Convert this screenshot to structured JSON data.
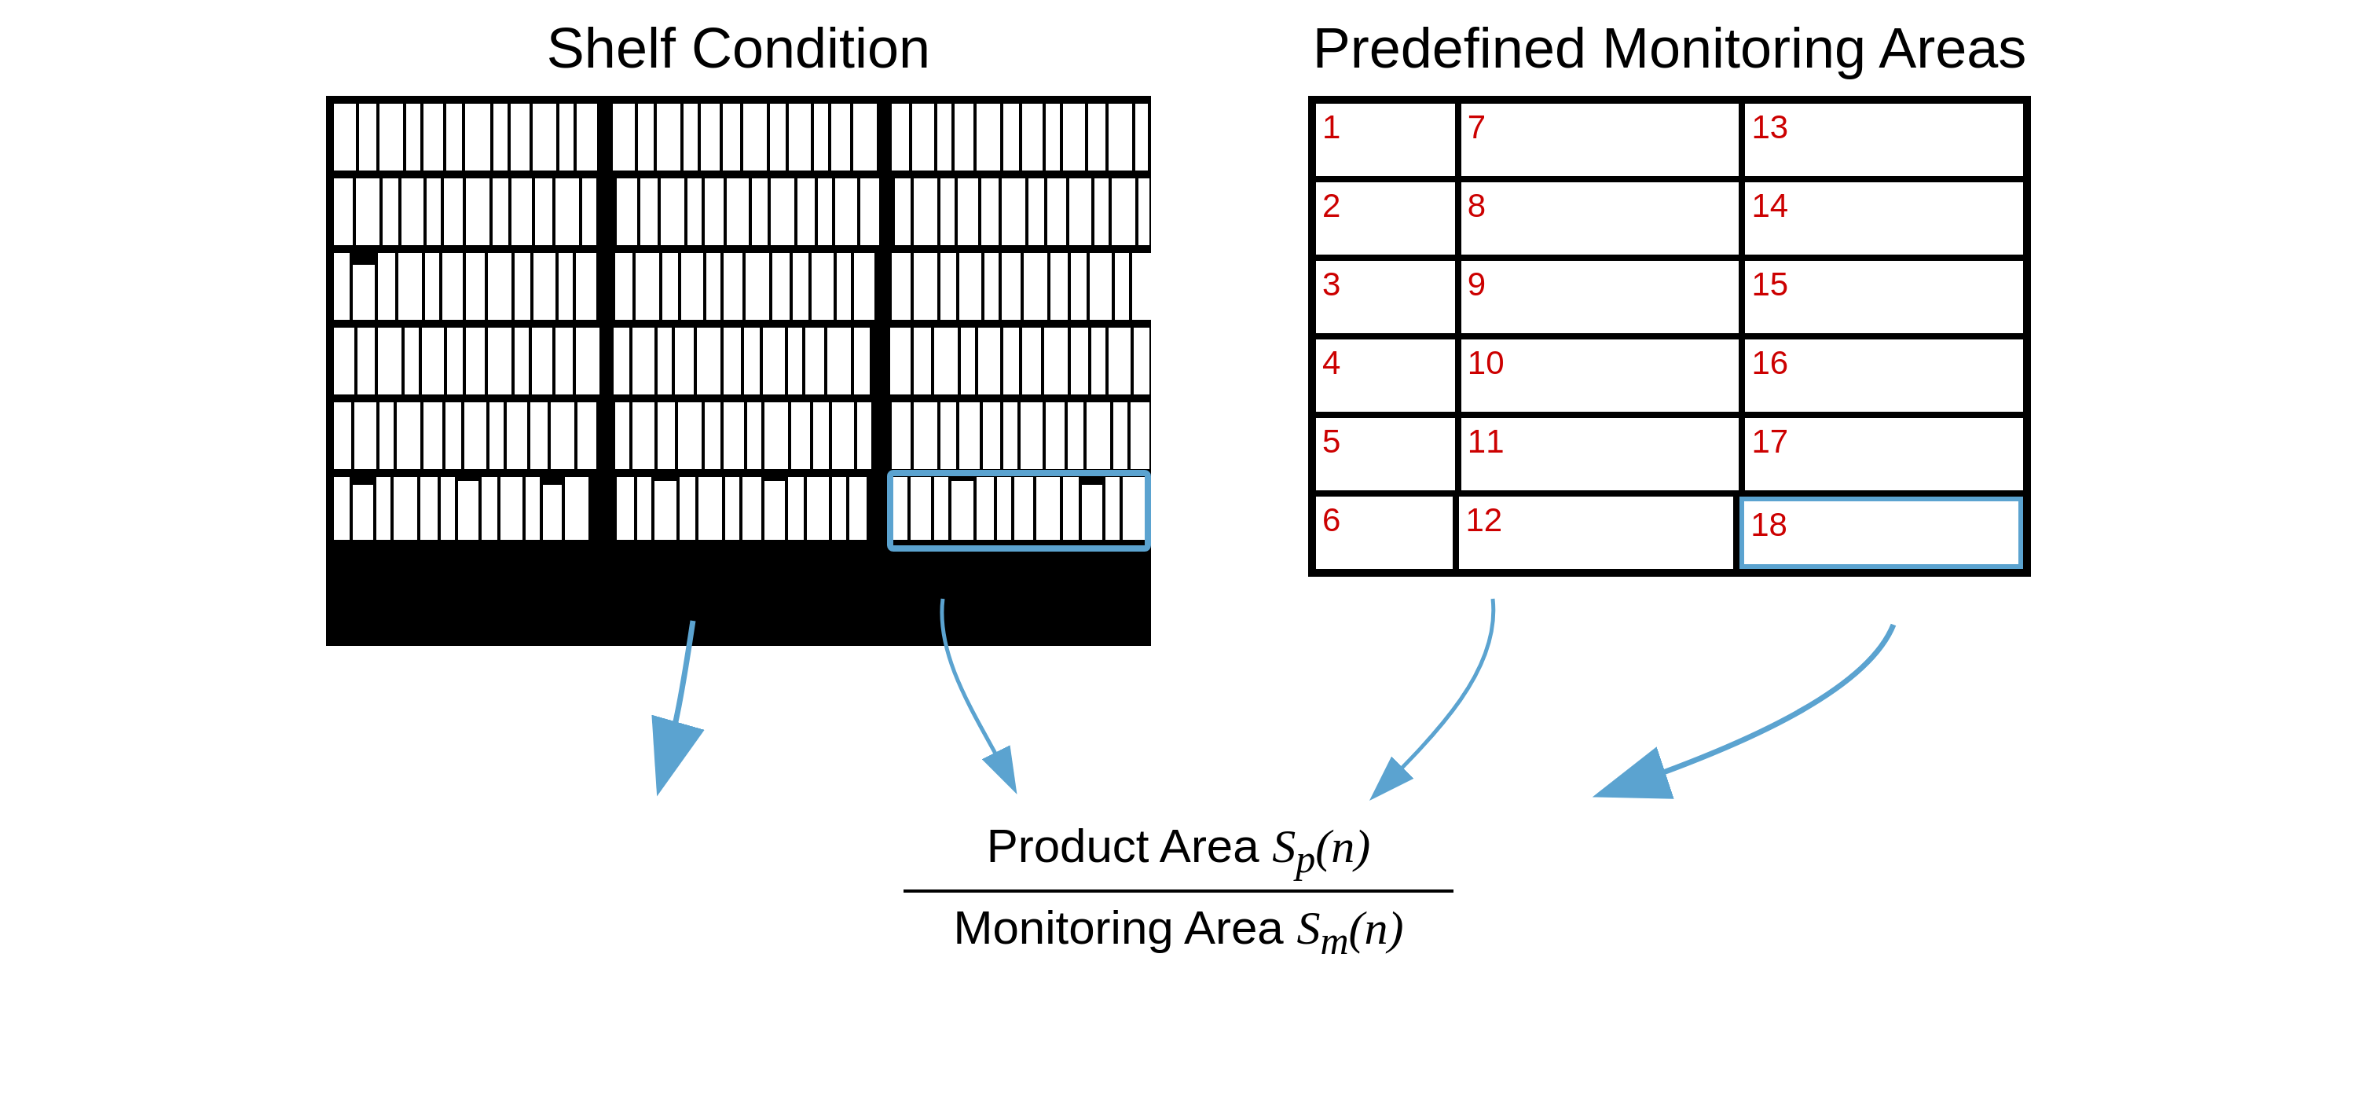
{
  "leftPanel": {
    "title": "Shelf Condition"
  },
  "rightPanel": {
    "title": "Predefined Monitoring Areas",
    "cells": [
      {
        "id": 1
      },
      {
        "id": 7
      },
      {
        "id": 13
      },
      {
        "id": 2
      },
      {
        "id": 8
      },
      {
        "id": 14
      },
      {
        "id": 3
      },
      {
        "id": 9
      },
      {
        "id": 15
      },
      {
        "id": 4
      },
      {
        "id": 10
      },
      {
        "id": 16
      },
      {
        "id": 5
      },
      {
        "id": 11
      },
      {
        "id": 17
      },
      {
        "id": 6
      },
      {
        "id": 12
      },
      {
        "id": 18
      }
    ],
    "highlightedCellId": 18
  },
  "formula": {
    "numeratorText": "Product Area ",
    "numeratorVar": "S",
    "numeratorSub": "p",
    "numeratorArg": "(n)",
    "denominatorText": "Monitoring Area ",
    "denominatorVar": "S",
    "denominatorSub": "m",
    "denominatorArg": "(n)"
  }
}
